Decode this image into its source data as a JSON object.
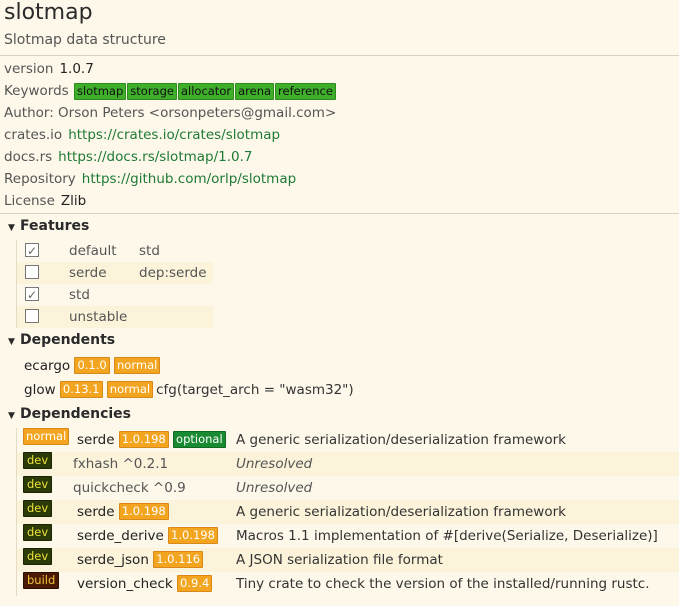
{
  "header": {
    "title": "slotmap",
    "subtitle": "Slotmap data structure"
  },
  "meta": {
    "version_label": "version",
    "version_value": "1.0.7",
    "keywords_label": "Keywords",
    "keywords": [
      "slotmap",
      "storage",
      "allocator",
      "arena",
      "reference"
    ],
    "author_text": "Author: Orson Peters <orsonpeters@gmail.com>",
    "crates_label": "crates.io",
    "crates_link": "https://crates.io/crates/slotmap",
    "docs_label": "docs.rs",
    "docs_link": "https://docs.rs/slotmap/1.0.7",
    "repo_label": "Repository",
    "repo_link": "https://github.com/orlp/slotmap",
    "license_label": "License",
    "license_value": "Zlib"
  },
  "features": {
    "heading": "Features",
    "items": [
      {
        "name": "default",
        "value": "std",
        "checked": true
      },
      {
        "name": "serde",
        "value": "dep:serde",
        "checked": false
      },
      {
        "name": "std",
        "value": "",
        "checked": true
      },
      {
        "name": "unstable",
        "value": "",
        "checked": false
      }
    ]
  },
  "dependents": {
    "heading": "Dependents",
    "items": [
      {
        "name": "ecargo",
        "version": "0.1.0",
        "kind": "normal",
        "cfg": ""
      },
      {
        "name": "glow",
        "version": "0.13.1",
        "kind": "normal",
        "cfg": "cfg(target_arch = \"wasm32\")"
      }
    ]
  },
  "dependencies": {
    "heading": "Dependencies",
    "items": [
      {
        "kind": "normal",
        "name": "serde",
        "version": "1.0.198",
        "optional": "optional",
        "desc": "A generic serialization/deserialization framework",
        "resolved": true
      },
      {
        "kind": "dev",
        "name": "fxhash ^0.2.1",
        "version": "",
        "optional": "",
        "desc": "Unresolved",
        "resolved": false
      },
      {
        "kind": "dev",
        "name": "quickcheck ^0.9",
        "version": "",
        "optional": "",
        "desc": "Unresolved",
        "resolved": false
      },
      {
        "kind": "dev",
        "name": "serde",
        "version": "1.0.198",
        "optional": "",
        "desc": "A generic serialization/deserialization framework",
        "resolved": true
      },
      {
        "kind": "dev",
        "name": "serde_derive",
        "version": "1.0.198",
        "optional": "",
        "desc": "Macros 1.1 implementation of #[derive(Serialize, Deserialize)]",
        "resolved": true
      },
      {
        "kind": "dev",
        "name": "serde_json",
        "version": "1.0.116",
        "optional": "",
        "desc": "A JSON serialization file format",
        "resolved": true
      },
      {
        "kind": "build",
        "name": "version_check",
        "version": "0.9.4",
        "optional": "",
        "desc": "Tiny crate to check the version of the installed/running rustc.",
        "resolved": true
      }
    ]
  },
  "icons": {
    "collapse": "triangle-down-icon",
    "checkbox": "checkbox-icon"
  },
  "colors": {
    "background": "#fdf8ea",
    "keyword": "#3fae2a",
    "link": "#1f7a35",
    "version_tag": "#f3a51f",
    "optional_tag": "#1a8a32",
    "dev_tag": "#2c3a08",
    "build_tag": "#4a1a04"
  }
}
